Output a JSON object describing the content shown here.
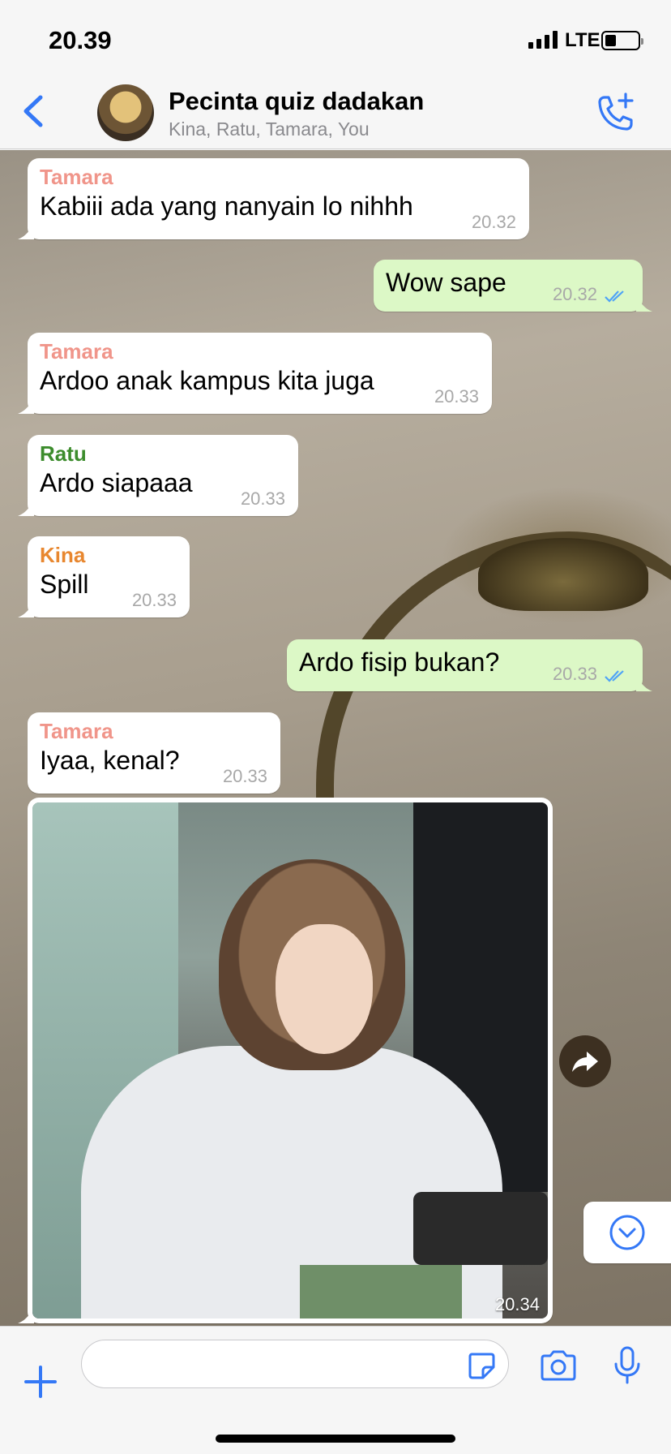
{
  "status_bar": {
    "time": "20.39",
    "network": "LTE"
  },
  "header": {
    "title": "Pecinta quiz dadakan",
    "members": "Kina, Ratu, Tamara, You"
  },
  "colors": {
    "accent": "#3478f6",
    "tamara": "#f0958a",
    "ratu": "#3c8c2c",
    "kina": "#e8872f",
    "outgoing_bubble": "#dcf8c6"
  },
  "messages": [
    {
      "sender": "Tamara",
      "text": "Kabiii ada yang nanyain lo nihhh",
      "time": "20.32"
    },
    {
      "sender": "You",
      "text": "Wow sape",
      "time": "20.32"
    },
    {
      "sender": "Tamara",
      "text": "Ardoo anak kampus kita juga",
      "time": "20.33"
    },
    {
      "sender": "Ratu",
      "text": "Ardo siapaaa",
      "time": "20.33"
    },
    {
      "sender": "Kina",
      "text": "Spill",
      "time": "20.33"
    },
    {
      "sender": "You",
      "text": "Ardo fisip bukan?",
      "time": "20.33"
    },
    {
      "sender": "Tamara",
      "text": "Iyaa, kenal?",
      "time": "20.33"
    },
    {
      "sender": "Tamara",
      "type": "photo",
      "time": "20.34"
    }
  ],
  "icons": {
    "back": "chevron-left-icon",
    "call": "add-call-icon",
    "forward": "forward-icon",
    "scroll_down": "chevron-down-circle-icon",
    "attach": "plus-icon",
    "sticker": "sticker-icon",
    "camera": "camera-icon",
    "mic": "microphone-icon"
  }
}
